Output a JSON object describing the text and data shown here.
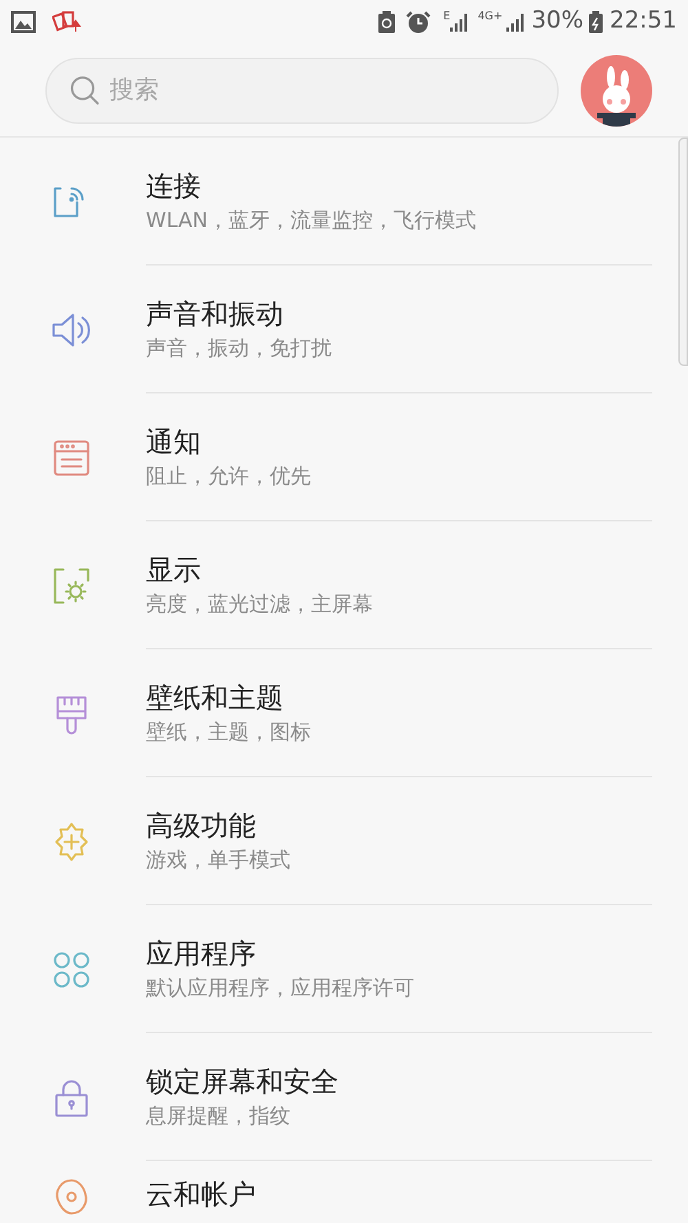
{
  "status_bar": {
    "network_e": "E",
    "network_4g": "4G+",
    "battery": "30%",
    "time": "22:51"
  },
  "search": {
    "placeholder": "搜索"
  },
  "items": [
    {
      "title": "连接",
      "subtitle": "WLAN，蓝牙，流量监控，飞行模式",
      "kind": "connection",
      "color": "#5b9fc8"
    },
    {
      "title": "声音和振动",
      "subtitle": "声音，振动，免打扰",
      "kind": "sound",
      "color": "#7b8fd6"
    },
    {
      "title": "通知",
      "subtitle": "阻止，允许，优先",
      "kind": "notification",
      "color": "#e08a80"
    },
    {
      "title": "显示",
      "subtitle": "亮度，蓝光过滤，主屏幕",
      "kind": "display",
      "color": "#98b85a"
    },
    {
      "title": "壁纸和主题",
      "subtitle": "壁纸，主题，图标",
      "kind": "brush",
      "color": "#b58fd8"
    },
    {
      "title": "高级功能",
      "subtitle": "游戏，单手模式",
      "kind": "advanced",
      "color": "#e3bf55"
    },
    {
      "title": "应用程序",
      "subtitle": "默认应用程序，应用程序许可",
      "kind": "apps",
      "color": "#6cb9c9"
    },
    {
      "title": "锁定屏幕和安全",
      "subtitle": "息屏提醒，指纹",
      "kind": "lock",
      "color": "#9a8fd4"
    },
    {
      "title": "云和帐户",
      "kind": "cloud",
      "color": "#e89a6a"
    }
  ]
}
